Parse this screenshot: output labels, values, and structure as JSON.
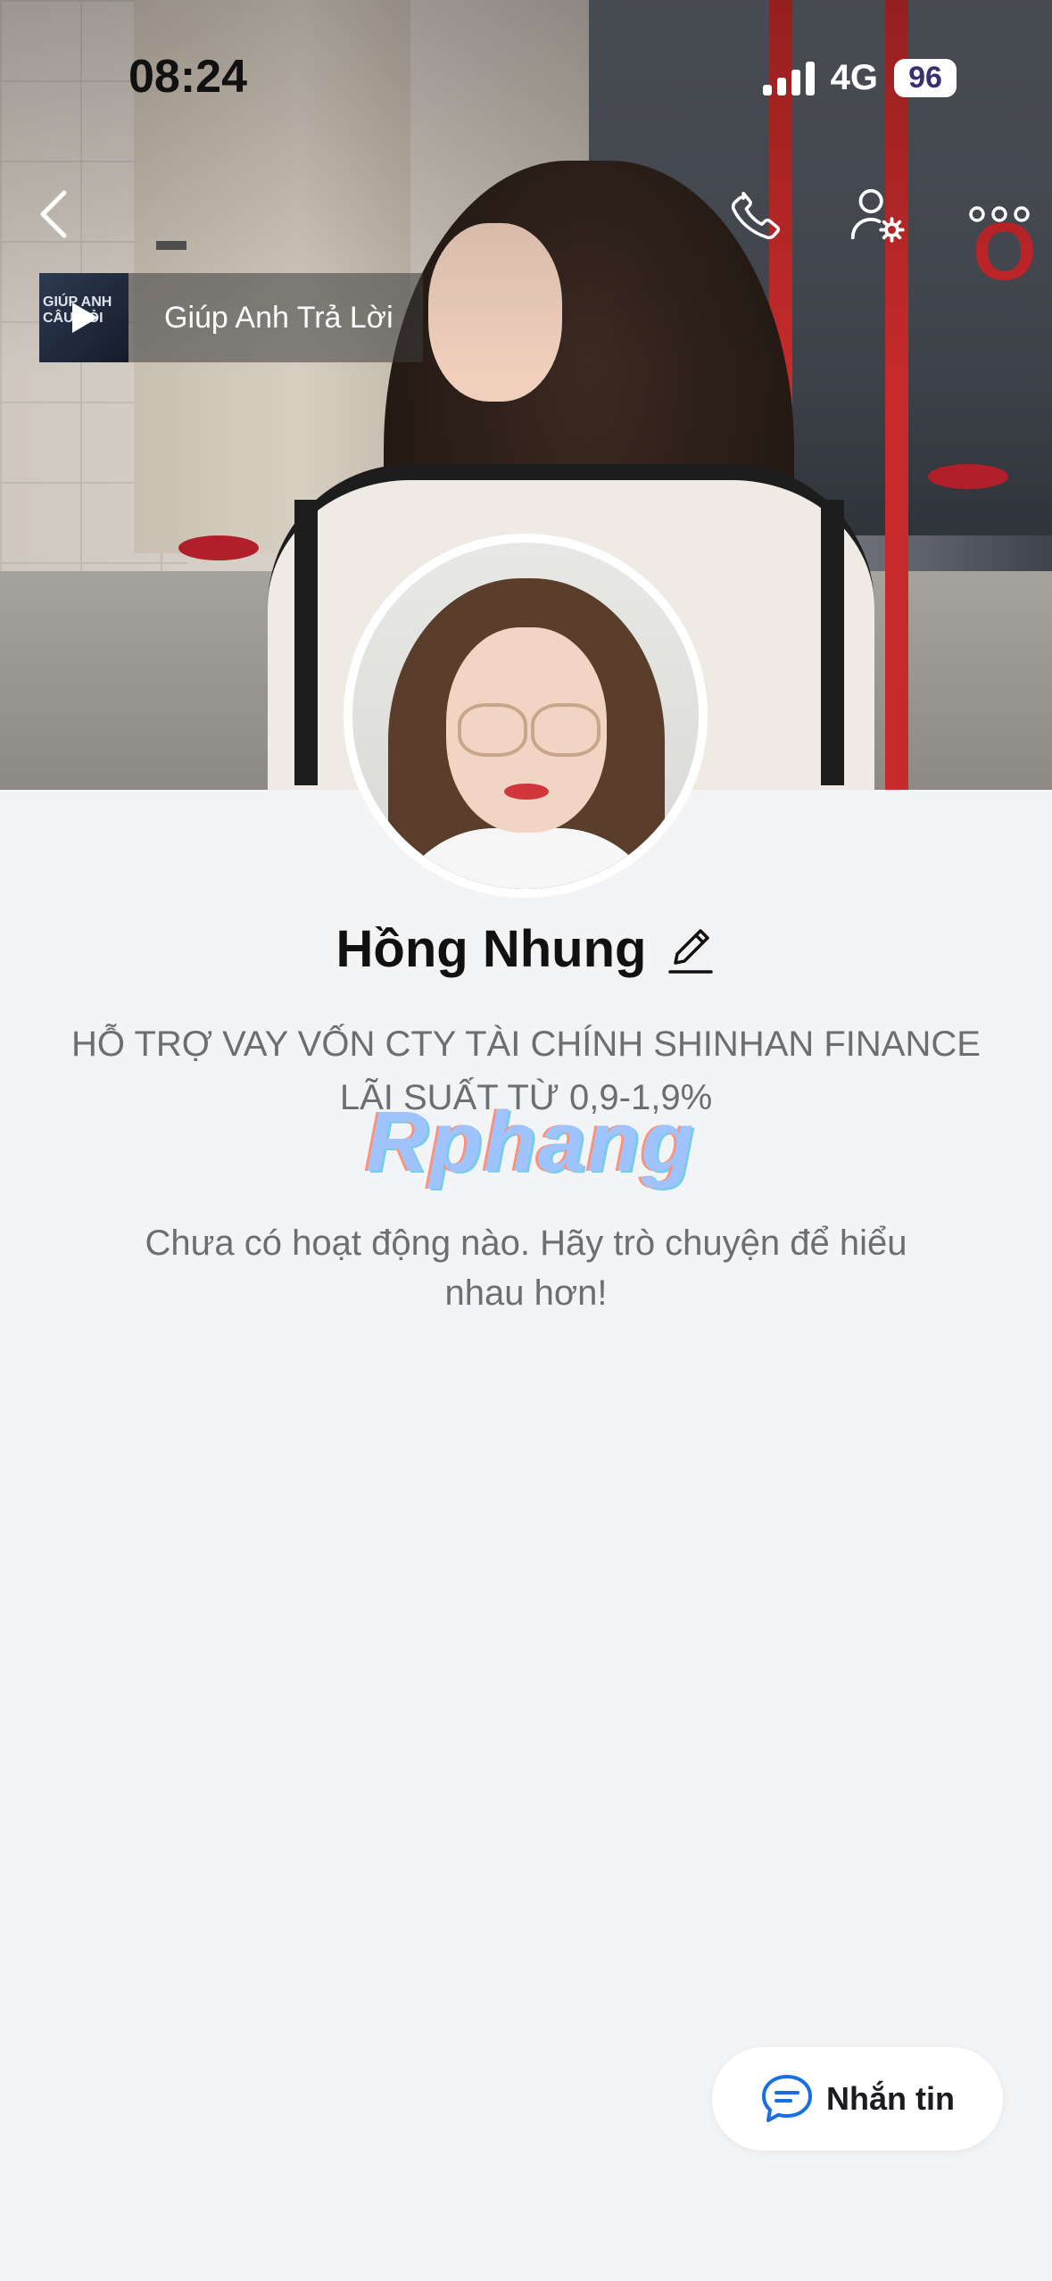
{
  "status_bar": {
    "time": "08:24",
    "network": "4G",
    "battery": "96"
  },
  "music": {
    "thumbnail_text": "GIÚP ANH CÂU HỎI",
    "title": "Giúp Anh Trả Lời"
  },
  "cover": {
    "sign_text": "O"
  },
  "profile": {
    "name": "Hồng Nhung",
    "bio_line1": "HỖ TRỢ VAY VỐN CTY TÀI CHÍNH SHINHAN FINANCE",
    "bio_line2": "LÃI SUẤT TỪ 0,9-1,9%",
    "empty_line1": "Chưa có hoạt động nào. Hãy trò chuyện để hiểu",
    "empty_line2": "nhau hơn!"
  },
  "watermark": "Rphang",
  "message_button": {
    "label": "Nhắn tin",
    "icon": "chat-bubble-icon"
  },
  "icons": {
    "back": "chevron-left-icon",
    "call": "phone-icon",
    "settings": "user-settings-icon",
    "more": "more-dots-icon",
    "edit": "pencil-icon",
    "play": "play-icon"
  },
  "colors": {
    "accent": "#1a6fe0",
    "background": "#f3f4f6",
    "text_primary": "#111111",
    "text_secondary": "#6b6e73"
  }
}
